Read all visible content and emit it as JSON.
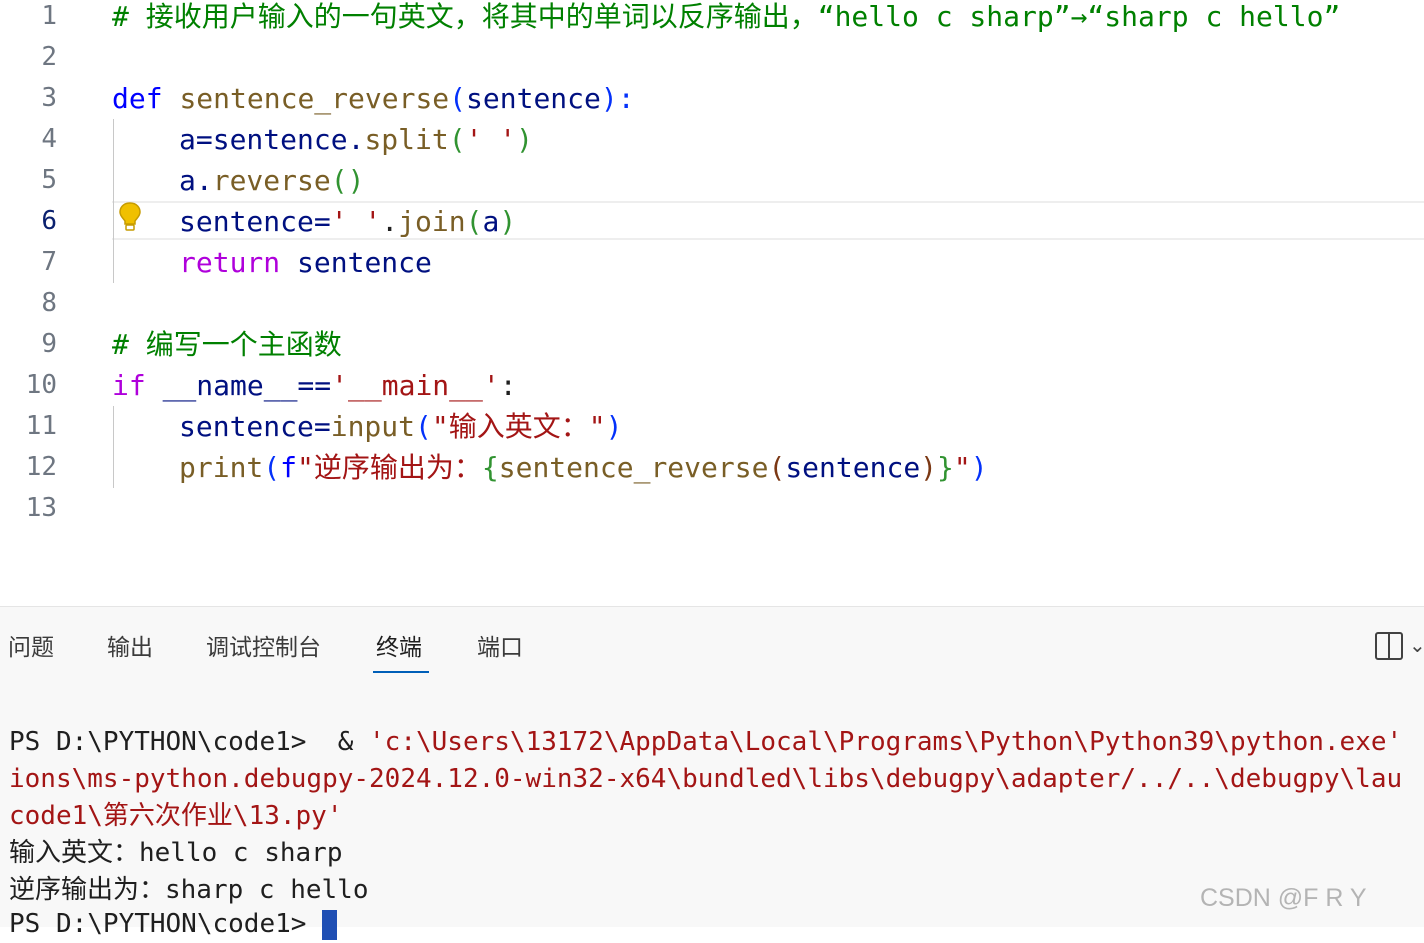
{
  "editor": {
    "line_numbers": [
      "1",
      "2",
      "3",
      "4",
      "5",
      "6",
      "7",
      "8",
      "9",
      "10",
      "11",
      "12",
      "13"
    ],
    "lines": {
      "l1_comment": "# 接收用户输入的一句英文，将其中的单词以反序输出，“hello c sharp”→“sharp c hello”",
      "l3_def": "def",
      "l3_fn": "sentence_reverse",
      "l3_p1": "(",
      "l3_param": "sentence",
      "l3_p2": "):",
      "l4_a": "a=sentence.",
      "l4_fn": "split",
      "l4_po": "(",
      "l4_str": "' '",
      "l4_pc": ")",
      "l5_a": "a.",
      "l5_fn": "reverse",
      "l5_p": "()",
      "l6_a": "sentence=",
      "l6_str": "' '",
      "l6_dot": ".",
      "l6_fn": "join",
      "l6_po": "(",
      "l6_arg": "a",
      "l6_pc": ")",
      "l7_ret": "return",
      "l7_var": " sentence",
      "l9_comment": "# 编写一个主函数",
      "l10_if": "if",
      "l10_name": " __name__==",
      "l10_str": "'__main__'",
      "l10_colon": ":",
      "l11_a": "sentence=",
      "l11_fn": "input",
      "l11_po": "(",
      "l11_str": "\"输入英文：\"",
      "l11_pc": ")",
      "l12_fn": "print",
      "l12_po": "(",
      "l12_f": "f",
      "l12_str1": "\"逆序输出为：",
      "l12_b1": "{",
      "l12_fn2": "sentence_reverse",
      "l12_p2o": "(",
      "l12_arg": "sentence",
      "l12_p2c": ")",
      "l12_b2": "}",
      "l12_str2": "\"",
      "l12_pc": ")"
    },
    "active_line": "6"
  },
  "panel": {
    "tabs": [
      "问题",
      "输出",
      "调试控制台",
      "终端",
      "端口"
    ],
    "active_tab": "终端"
  },
  "terminal": {
    "l1_prompt": "PS D:\\PYTHON\\code1>  & ",
    "l1_path": "'c:\\Users\\13172\\AppData\\Local\\Programs\\Python\\Python39\\python.exe'",
    "l2": "ions\\ms-python.debugpy-2024.12.0-win32-x64\\bundled\\libs\\debugpy\\adapter/../..\\debugpy\\lau",
    "l3": "code1\\第六次作业\\13.py'",
    "l4": "输入英文：hello c sharp",
    "l5": "逆序输出为：sharp c hello",
    "l6_prompt": "PS D:\\PYTHON\\code1> "
  },
  "watermark": "CSDN @F R Y",
  "colors": {
    "comment": "#008000",
    "keyword": "#0000ff",
    "control_keyword": "#af00db",
    "function": "#795e26",
    "parameter": "#001080",
    "string": "#a31515",
    "active_tab_underline": "#005fb8"
  }
}
